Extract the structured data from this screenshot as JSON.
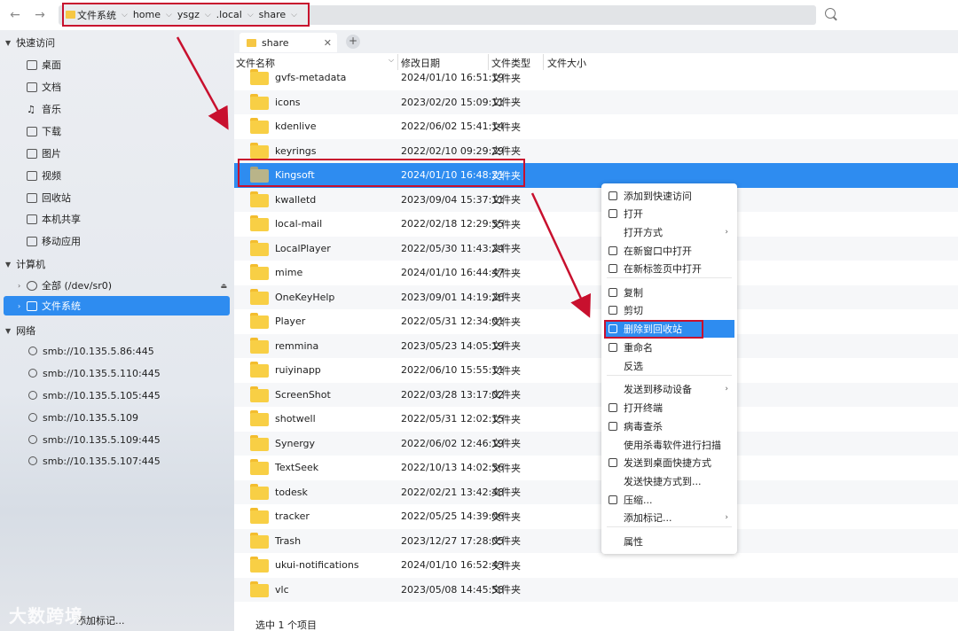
{
  "toolbar": {
    "back": "←",
    "forward": "→",
    "breadcrumbs": [
      "文件系统",
      "home",
      "ysgz",
      ".local",
      "share"
    ]
  },
  "sidebar": {
    "quick_access": "快速访问",
    "quick_items": [
      "桌面",
      "文档",
      "音乐",
      "下载",
      "图片",
      "视频",
      "回收站",
      "本机共享",
      "移动应用"
    ],
    "computer": "计算机",
    "computer_items": [
      "全部 (/dev/sr0)",
      "文件系统"
    ],
    "network": "网络",
    "network_items": [
      "smb://10.135.5.86:445",
      "smb://10.135.5.110:445",
      "smb://10.135.5.105:445",
      "smb://10.135.5.109",
      "smb://10.135.5.109:445",
      "smb://10.135.5.107:445"
    ],
    "footer": "添加标记..."
  },
  "tab": {
    "label": "share",
    "close": "✕",
    "add": "+"
  },
  "columns": {
    "name": "文件名称",
    "modified": "修改日期",
    "type": "文件类型",
    "size": "文件大小"
  },
  "files": [
    {
      "name": "gvfs-metadata",
      "date": "2024/01/10 16:51:19",
      "type": "文件夹"
    },
    {
      "name": "icons",
      "date": "2023/02/20 15:09:11",
      "type": "文件夹"
    },
    {
      "name": "kdenlive",
      "date": "2022/06/02 15:41:14",
      "type": "文件夹"
    },
    {
      "name": "keyrings",
      "date": "2022/02/10 09:29:29",
      "type": "文件夹"
    },
    {
      "name": "Kingsoft",
      "date": "2024/01/10 16:48:21",
      "type": "文件夹"
    },
    {
      "name": "kwalletd",
      "date": "2023/09/04 15:37:11",
      "type": "文件夹"
    },
    {
      "name": "local-mail",
      "date": "2022/02/18 12:29:55",
      "type": "文件夹"
    },
    {
      "name": "LocalPlayer",
      "date": "2022/05/30 11:43:24",
      "type": "文件夹"
    },
    {
      "name": "mime",
      "date": "2024/01/10 16:44:47",
      "type": "文件夹"
    },
    {
      "name": "OneKeyHelp",
      "date": "2023/09/01 14:19:26",
      "type": "文件夹"
    },
    {
      "name": "Player",
      "date": "2022/05/31 12:34:01",
      "type": "文件夹"
    },
    {
      "name": "remmina",
      "date": "2023/05/23 14:05:19",
      "type": "文件夹"
    },
    {
      "name": "ruiyinapp",
      "date": "2022/06/10 15:55:11",
      "type": "文件夹"
    },
    {
      "name": "ScreenShot",
      "date": "2022/03/28 13:17:02",
      "type": "文件夹"
    },
    {
      "name": "shotwell",
      "date": "2022/05/31 12:02:15",
      "type": "文件夹"
    },
    {
      "name": "Synergy",
      "date": "2022/06/02 12:46:19",
      "type": "文件夹"
    },
    {
      "name": "TextSeek",
      "date": "2022/10/13 14:02:56",
      "type": "文件夹"
    },
    {
      "name": "todesk",
      "date": "2022/02/21 13:42:48",
      "type": "文件夹"
    },
    {
      "name": "tracker",
      "date": "2022/05/25 14:39:06",
      "type": "文件夹"
    },
    {
      "name": "Trash",
      "date": "2023/12/27 17:28:05",
      "type": "文件夹"
    },
    {
      "name": "ukui-notifications",
      "date": "2024/01/10 16:52:43",
      "type": "文件夹"
    },
    {
      "name": "vlc",
      "date": "2023/05/08 14:45:58",
      "type": "文件夹"
    }
  ],
  "selected_file": "Kingsoft",
  "status": "选中 1 个项目",
  "context_menu": [
    {
      "label": "添加到快速访问",
      "icon": "pin-icon"
    },
    {
      "label": "打开",
      "icon": "open-folder-icon"
    },
    {
      "label": "打开方式",
      "icon": "",
      "submenu": true
    },
    {
      "label": "在新窗口中打开",
      "icon": "window-icon"
    },
    {
      "label": "在新标签页中打开",
      "icon": "tab-icon"
    },
    {
      "label": "复制",
      "icon": "copy-icon"
    },
    {
      "label": "剪切",
      "icon": "cut-icon"
    },
    {
      "label": "删除到回收站",
      "icon": "trash-icon",
      "highlighted": true
    },
    {
      "label": "重命名",
      "icon": "rename-icon"
    },
    {
      "label": "反选",
      "icon": ""
    },
    {
      "label": "发送到移动设备",
      "icon": "",
      "submenu": true
    },
    {
      "label": "打开终端",
      "icon": "terminal-icon"
    },
    {
      "label": "病毒查杀",
      "icon": "antivirus-icon"
    },
    {
      "label": "使用杀毒软件进行扫描",
      "icon": ""
    },
    {
      "label": "发送到桌面快捷方式",
      "icon": "shortcut-icon"
    },
    {
      "label": "发送快捷方式到...",
      "icon": ""
    },
    {
      "label": "压缩...",
      "icon": "archive-icon"
    },
    {
      "label": "添加标记...",
      "icon": "",
      "submenu": true
    },
    {
      "label": "属性",
      "icon": ""
    }
  ],
  "watermark": "大数跨境",
  "colors": {
    "accent": "#2e8cf0",
    "annotation": "#c8102e",
    "folder": "#f8cf45"
  }
}
